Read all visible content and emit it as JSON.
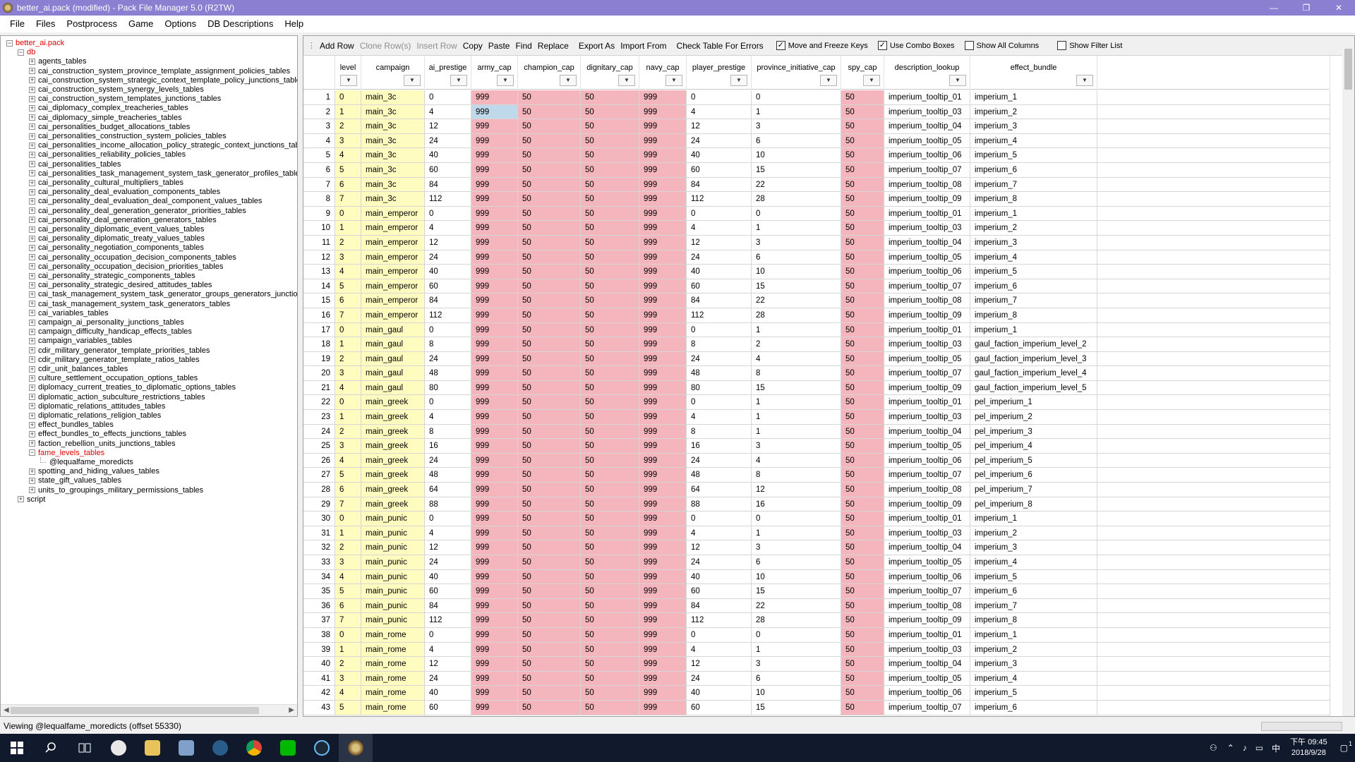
{
  "window": {
    "title": "better_ai.pack (modified) - Pack File Manager 5.0 (R2TW)",
    "minimize": "—",
    "maximize": "❐",
    "close": "✕"
  },
  "menu": [
    "File",
    "Files",
    "Postprocess",
    "Game",
    "Options",
    "DB Descriptions",
    "Help"
  ],
  "tree": {
    "root": "better_ai.pack",
    "db": "db",
    "tables": [
      "agents_tables",
      "cai_construction_system_province_template_assignment_policies_tables",
      "cai_construction_system_strategic_context_template_policy_junctions_table",
      "cai_construction_system_synergy_levels_tables",
      "cai_construction_system_templates_junctions_tables",
      "cai_diplomacy_complex_treacheries_tables",
      "cai_diplomacy_simple_treacheries_tables",
      "cai_personalities_budget_allocations_tables",
      "cai_personalities_construction_system_policies_tables",
      "cai_personalities_income_allocation_policy_strategic_context_junctions_tab",
      "cai_personalities_reliability_policies_tables",
      "cai_personalities_tables",
      "cai_personalities_task_management_system_task_generator_profiles_tables",
      "cai_personality_cultural_multipliers_tables",
      "cai_personality_deal_evaluation_components_tables",
      "cai_personality_deal_evaluation_deal_component_values_tables",
      "cai_personality_deal_generation_generator_priorities_tables",
      "cai_personality_deal_generation_generators_tables",
      "cai_personality_diplomatic_event_values_tables",
      "cai_personality_diplomatic_treaty_values_tables",
      "cai_personality_negotiation_components_tables",
      "cai_personality_occupation_decision_components_tables",
      "cai_personality_occupation_decision_priorities_tables",
      "cai_personality_strategic_components_tables",
      "cai_personality_strategic_desired_attitudes_tables",
      "cai_task_management_system_task_generator_groups_generators_junctior",
      "cai_task_management_system_task_generators_tables",
      "cai_variables_tables",
      "campaign_ai_personality_junctions_tables",
      "campaign_difficulty_handicap_effects_tables",
      "campaign_variables_tables",
      "cdir_military_generator_template_priorities_tables",
      "cdir_military_generator_template_ratios_tables",
      "cdir_unit_balances_tables",
      "culture_settlement_occupation_options_tables",
      "diplomacy_current_treaties_to_diplomatic_options_tables",
      "diplomatic_action_subculture_restrictions_tables",
      "diplomatic_relations_attitudes_tables",
      "diplomatic_relations_religion_tables",
      "effect_bundles_tables",
      "effect_bundles_to_effects_junctions_tables",
      "faction_rebellion_units_junctions_tables"
    ],
    "open_table": "fame_levels_tables",
    "open_file": "@lequalfame_moredicts",
    "tables_after": [
      "spotting_and_hiding_values_tables",
      "state_gift_values_tables",
      "units_to_groupings_military_permissions_tables"
    ],
    "script": "script"
  },
  "toolbar": {
    "buttons": [
      "Add Row",
      "Clone Row(s)",
      "Insert Row",
      "Copy",
      "Paste",
      "Find",
      "Replace",
      "Export As",
      "Import From",
      "Check Table For Errors"
    ],
    "checks": [
      {
        "label": "Move and Freeze Keys",
        "checked": true
      },
      {
        "label": "Use Combo Boxes",
        "checked": true
      },
      {
        "label": "Show All Columns",
        "checked": false
      },
      {
        "label": "Show Filter List",
        "checked": false
      }
    ]
  },
  "columns": [
    "level",
    "campaign",
    "ai_prestige",
    "army_cap",
    "champion_cap",
    "dignitary_cap",
    "navy_cap",
    "player_prestige",
    "province_initiative_cap",
    "spy_cap",
    "description_lookup",
    "effect_bundle"
  ],
  "rows": [
    [
      "1",
      "0",
      "main_3c",
      "0",
      "999",
      "50",
      "50",
      "999",
      "0",
      "0",
      "50",
      "imperium_tooltip_01",
      "imperium_1"
    ],
    [
      "2",
      "1",
      "main_3c",
      "4",
      "999",
      "50",
      "50",
      "999",
      "4",
      "1",
      "50",
      "imperium_tooltip_03",
      "imperium_2"
    ],
    [
      "3",
      "2",
      "main_3c",
      "12",
      "999",
      "50",
      "50",
      "999",
      "12",
      "3",
      "50",
      "imperium_tooltip_04",
      "imperium_3"
    ],
    [
      "4",
      "3",
      "main_3c",
      "24",
      "999",
      "50",
      "50",
      "999",
      "24",
      "6",
      "50",
      "imperium_tooltip_05",
      "imperium_4"
    ],
    [
      "5",
      "4",
      "main_3c",
      "40",
      "999",
      "50",
      "50",
      "999",
      "40",
      "10",
      "50",
      "imperium_tooltip_06",
      "imperium_5"
    ],
    [
      "6",
      "5",
      "main_3c",
      "60",
      "999",
      "50",
      "50",
      "999",
      "60",
      "15",
      "50",
      "imperium_tooltip_07",
      "imperium_6"
    ],
    [
      "7",
      "6",
      "main_3c",
      "84",
      "999",
      "50",
      "50",
      "999",
      "84",
      "22",
      "50",
      "imperium_tooltip_08",
      "imperium_7"
    ],
    [
      "8",
      "7",
      "main_3c",
      "112",
      "999",
      "50",
      "50",
      "999",
      "112",
      "28",
      "50",
      "imperium_tooltip_09",
      "imperium_8"
    ],
    [
      "9",
      "0",
      "main_emperor",
      "0",
      "999",
      "50",
      "50",
      "999",
      "0",
      "0",
      "50",
      "imperium_tooltip_01",
      "imperium_1"
    ],
    [
      "10",
      "1",
      "main_emperor",
      "4",
      "999",
      "50",
      "50",
      "999",
      "4",
      "1",
      "50",
      "imperium_tooltip_03",
      "imperium_2"
    ],
    [
      "11",
      "2",
      "main_emperor",
      "12",
      "999",
      "50",
      "50",
      "999",
      "12",
      "3",
      "50",
      "imperium_tooltip_04",
      "imperium_3"
    ],
    [
      "12",
      "3",
      "main_emperor",
      "24",
      "999",
      "50",
      "50",
      "999",
      "24",
      "6",
      "50",
      "imperium_tooltip_05",
      "imperium_4"
    ],
    [
      "13",
      "4",
      "main_emperor",
      "40",
      "999",
      "50",
      "50",
      "999",
      "40",
      "10",
      "50",
      "imperium_tooltip_06",
      "imperium_5"
    ],
    [
      "14",
      "5",
      "main_emperor",
      "60",
      "999",
      "50",
      "50",
      "999",
      "60",
      "15",
      "50",
      "imperium_tooltip_07",
      "imperium_6"
    ],
    [
      "15",
      "6",
      "main_emperor",
      "84",
      "999",
      "50",
      "50",
      "999",
      "84",
      "22",
      "50",
      "imperium_tooltip_08",
      "imperium_7"
    ],
    [
      "16",
      "7",
      "main_emperor",
      "112",
      "999",
      "50",
      "50",
      "999",
      "112",
      "28",
      "50",
      "imperium_tooltip_09",
      "imperium_8"
    ],
    [
      "17",
      "0",
      "main_gaul",
      "0",
      "999",
      "50",
      "50",
      "999",
      "0",
      "1",
      "50",
      "imperium_tooltip_01",
      "imperium_1"
    ],
    [
      "18",
      "1",
      "main_gaul",
      "8",
      "999",
      "50",
      "50",
      "999",
      "8",
      "2",
      "50",
      "imperium_tooltip_03",
      "gaul_faction_imperium_level_2"
    ],
    [
      "19",
      "2",
      "main_gaul",
      "24",
      "999",
      "50",
      "50",
      "999",
      "24",
      "4",
      "50",
      "imperium_tooltip_05",
      "gaul_faction_imperium_level_3"
    ],
    [
      "20",
      "3",
      "main_gaul",
      "48",
      "999",
      "50",
      "50",
      "999",
      "48",
      "8",
      "50",
      "imperium_tooltip_07",
      "gaul_faction_imperium_level_4"
    ],
    [
      "21",
      "4",
      "main_gaul",
      "80",
      "999",
      "50",
      "50",
      "999",
      "80",
      "15",
      "50",
      "imperium_tooltip_09",
      "gaul_faction_imperium_level_5"
    ],
    [
      "22",
      "0",
      "main_greek",
      "0",
      "999",
      "50",
      "50",
      "999",
      "0",
      "1",
      "50",
      "imperium_tooltip_01",
      "pel_imperium_1"
    ],
    [
      "23",
      "1",
      "main_greek",
      "4",
      "999",
      "50",
      "50",
      "999",
      "4",
      "1",
      "50",
      "imperium_tooltip_03",
      "pel_imperium_2"
    ],
    [
      "24",
      "2",
      "main_greek",
      "8",
      "999",
      "50",
      "50",
      "999",
      "8",
      "1",
      "50",
      "imperium_tooltip_04",
      "pel_imperium_3"
    ],
    [
      "25",
      "3",
      "main_greek",
      "16",
      "999",
      "50",
      "50",
      "999",
      "16",
      "3",
      "50",
      "imperium_tooltip_05",
      "pel_imperium_4"
    ],
    [
      "26",
      "4",
      "main_greek",
      "24",
      "999",
      "50",
      "50",
      "999",
      "24",
      "4",
      "50",
      "imperium_tooltip_06",
      "pel_imperium_5"
    ],
    [
      "27",
      "5",
      "main_greek",
      "48",
      "999",
      "50",
      "50",
      "999",
      "48",
      "8",
      "50",
      "imperium_tooltip_07",
      "pel_imperium_6"
    ],
    [
      "28",
      "6",
      "main_greek",
      "64",
      "999",
      "50",
      "50",
      "999",
      "64",
      "12",
      "50",
      "imperium_tooltip_08",
      "pel_imperium_7"
    ],
    [
      "29",
      "7",
      "main_greek",
      "88",
      "999",
      "50",
      "50",
      "999",
      "88",
      "16",
      "50",
      "imperium_tooltip_09",
      "pel_imperium_8"
    ],
    [
      "30",
      "0",
      "main_punic",
      "0",
      "999",
      "50",
      "50",
      "999",
      "0",
      "0",
      "50",
      "imperium_tooltip_01",
      "imperium_1"
    ],
    [
      "31",
      "1",
      "main_punic",
      "4",
      "999",
      "50",
      "50",
      "999",
      "4",
      "1",
      "50",
      "imperium_tooltip_03",
      "imperium_2"
    ],
    [
      "32",
      "2",
      "main_punic",
      "12",
      "999",
      "50",
      "50",
      "999",
      "12",
      "3",
      "50",
      "imperium_tooltip_04",
      "imperium_3"
    ],
    [
      "33",
      "3",
      "main_punic",
      "24",
      "999",
      "50",
      "50",
      "999",
      "24",
      "6",
      "50",
      "imperium_tooltip_05",
      "imperium_4"
    ],
    [
      "34",
      "4",
      "main_punic",
      "40",
      "999",
      "50",
      "50",
      "999",
      "40",
      "10",
      "50",
      "imperium_tooltip_06",
      "imperium_5"
    ],
    [
      "35",
      "5",
      "main_punic",
      "60",
      "999",
      "50",
      "50",
      "999",
      "60",
      "15",
      "50",
      "imperium_tooltip_07",
      "imperium_6"
    ],
    [
      "36",
      "6",
      "main_punic",
      "84",
      "999",
      "50",
      "50",
      "999",
      "84",
      "22",
      "50",
      "imperium_tooltip_08",
      "imperium_7"
    ],
    [
      "37",
      "7",
      "main_punic",
      "112",
      "999",
      "50",
      "50",
      "999",
      "112",
      "28",
      "50",
      "imperium_tooltip_09",
      "imperium_8"
    ],
    [
      "38",
      "0",
      "main_rome",
      "0",
      "999",
      "50",
      "50",
      "999",
      "0",
      "0",
      "50",
      "imperium_tooltip_01",
      "imperium_1"
    ],
    [
      "39",
      "1",
      "main_rome",
      "4",
      "999",
      "50",
      "50",
      "999",
      "4",
      "1",
      "50",
      "imperium_tooltip_03",
      "imperium_2"
    ],
    [
      "40",
      "2",
      "main_rome",
      "12",
      "999",
      "50",
      "50",
      "999",
      "12",
      "3",
      "50",
      "imperium_tooltip_04",
      "imperium_3"
    ],
    [
      "41",
      "3",
      "main_rome",
      "24",
      "999",
      "50",
      "50",
      "999",
      "24",
      "6",
      "50",
      "imperium_tooltip_05",
      "imperium_4"
    ],
    [
      "42",
      "4",
      "main_rome",
      "40",
      "999",
      "50",
      "50",
      "999",
      "40",
      "10",
      "50",
      "imperium_tooltip_06",
      "imperium_5"
    ],
    [
      "43",
      "5",
      "main_rome",
      "60",
      "999",
      "50",
      "50",
      "999",
      "60",
      "15",
      "50",
      "imperium_tooltip_07",
      "imperium_6"
    ]
  ],
  "status": "Viewing @lequalfame_moredicts (offset 55330)",
  "taskbar": {
    "time": "下午 09:45",
    "date": "2018/9/28",
    "ime": "中",
    "notifications": "1"
  },
  "colors": {
    "key_column": "#fffcc0",
    "cap_column": "#f4b5bd",
    "selected_cell": "#bfd8ea",
    "titlebar": "#8a7fd0",
    "taskbar": "#101a2c"
  }
}
